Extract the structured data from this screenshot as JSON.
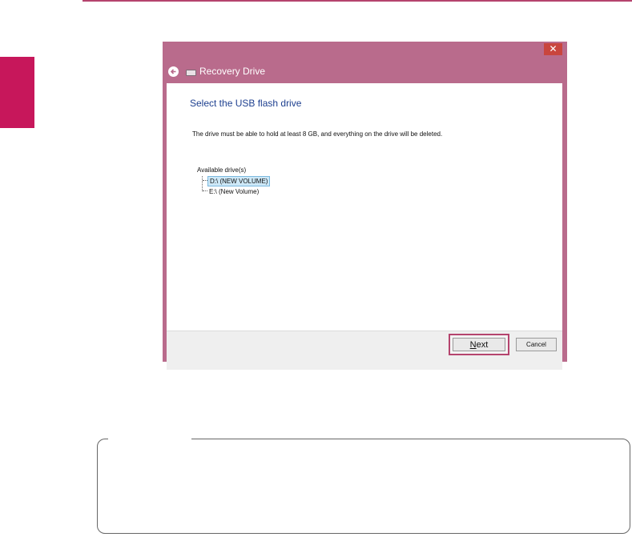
{
  "window": {
    "close_symbol": "✕",
    "nav_title": "Recovery Drive",
    "heading": "Select the USB flash drive",
    "description": "The drive must be able to hold at least 8 GB, and everything on the drive will be deleted.",
    "available_label": "Available drive(s)",
    "drives": [
      {
        "label": "D:\\ (NEW VOLUME)",
        "selected": true
      },
      {
        "label": "E:\\ (New Volume)",
        "selected": false
      }
    ],
    "next_first": "N",
    "next_rest": "ext",
    "cancel_label": "Cancel"
  },
  "colors": {
    "accent": "#c7175b",
    "window_chrome": "#b96b8c",
    "heading_blue": "#1d3f8f"
  },
  "icons": {
    "back": "back-arrow-icon",
    "drive": "usb-drive-icon",
    "close": "close-icon"
  }
}
